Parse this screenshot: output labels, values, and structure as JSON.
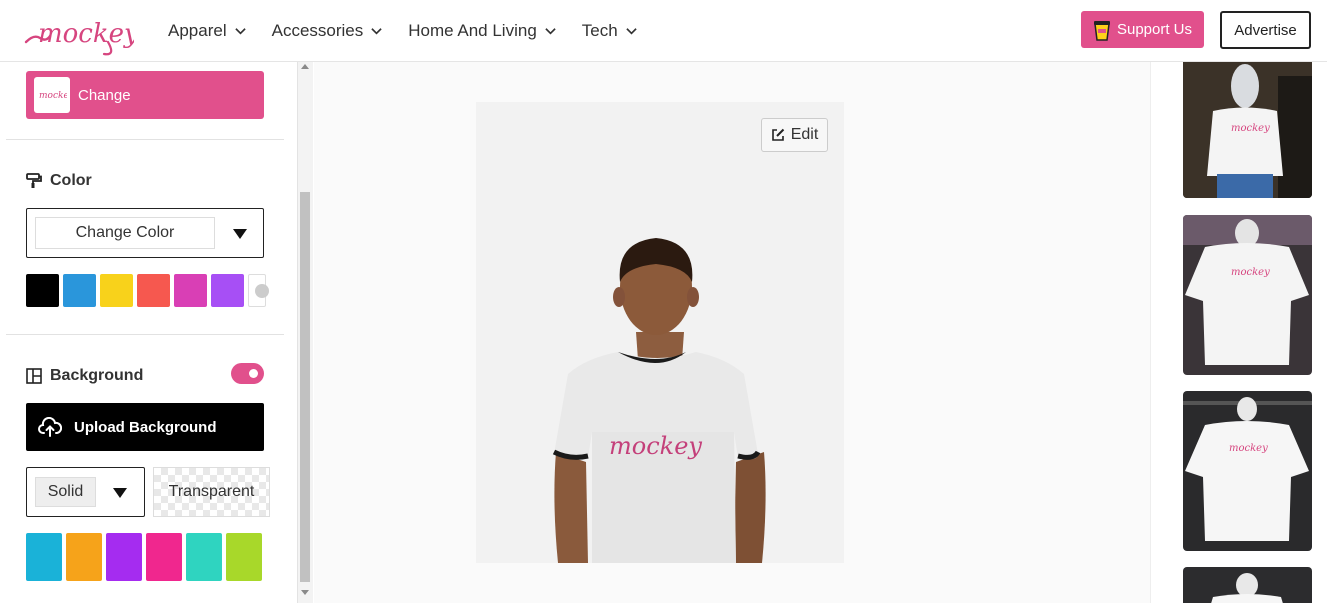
{
  "header": {
    "logo_text": "mockey",
    "nav": [
      {
        "label": "Apparel"
      },
      {
        "label": "Accessories"
      },
      {
        "label": "Home And Living"
      },
      {
        "label": "Tech"
      }
    ],
    "support_label": "Support Us",
    "advertise_label": "Advertise"
  },
  "sidebar": {
    "change_label": "Change",
    "color_title": "Color",
    "color_select_label": "Change Color",
    "color_swatches": [
      "#000000",
      "#2a96db",
      "#f8d21b",
      "#f6584f",
      "#d93fb5",
      "#a74ff5",
      "#ffffff"
    ],
    "background_title": "Background",
    "background_toggle_on": true,
    "upload_label": "Upload Background",
    "solid_label": "Solid",
    "transparent_label": "Transparent",
    "pattern_colors": [
      "#1ab2d8",
      "#f6a31a",
      "#a52cf0",
      "#f0278e",
      "#2fd4c0",
      "#a8d82a"
    ]
  },
  "canvas": {
    "edit_label": "Edit",
    "shirt_logo_text": "mockey"
  },
  "colors": {
    "brand_pink": "#e1508c",
    "black": "#000000"
  }
}
